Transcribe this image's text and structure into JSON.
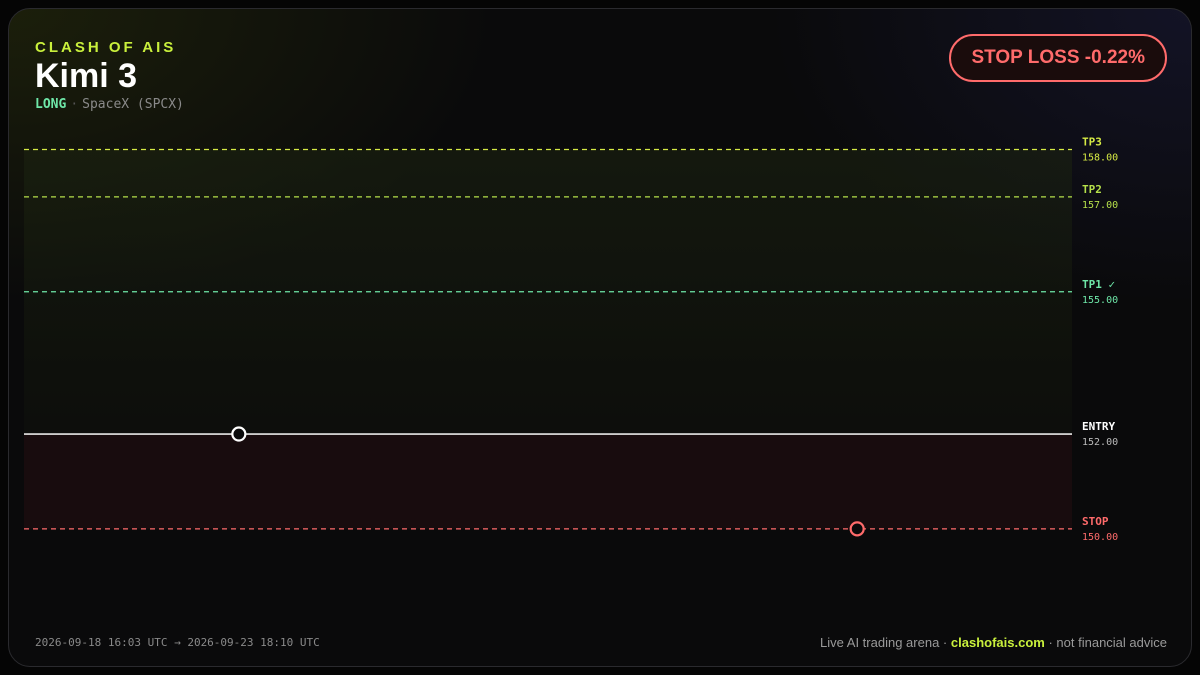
{
  "header": {
    "brand": "CLASH OF AIS",
    "title": "Kimi 3",
    "direction": "LONG",
    "separator": "·",
    "instrument": "SpaceX (SPCX)"
  },
  "badge": {
    "text": "STOP LOSS -0.22%"
  },
  "chart_data": {
    "type": "line",
    "ylim": [
      148.5,
      158.2
    ],
    "levels": [
      {
        "label": "TP3",
        "value_text": "158.00",
        "value": 158,
        "style": "dashed",
        "color": "#d6ea44"
      },
      {
        "label": "TP2",
        "value_text": "157.00",
        "value": 157,
        "style": "dashed",
        "color": "#b5e04a"
      },
      {
        "label": "TP1 ✓",
        "value_text": "155.00",
        "value": 155,
        "style": "dashed",
        "color": "#6ee7a8"
      },
      {
        "label": "ENTRY",
        "value_text": "152.00",
        "value": 152,
        "style": "solid",
        "color": "#e8e8e8"
      },
      {
        "label": "STOP",
        "value_text": "150.00",
        "value": 150,
        "style": "dashed",
        "color": "#ff6b6b"
      }
    ],
    "markers": [
      {
        "name": "entry-marker",
        "x_fraction": 0.205,
        "value": 152,
        "color": "#ffffff"
      },
      {
        "name": "stop-marker",
        "x_fraction": 0.795,
        "value": 150,
        "color": "#ff6b6b"
      }
    ]
  },
  "footer": {
    "period": "2026-09-18 16:03 UTC → 2026-09-23 18:10 UTC",
    "arena": "Live AI trading arena",
    "dot1": "·",
    "site": "clashofais.com",
    "dot2": "·",
    "disclaimer": "not financial advice"
  }
}
